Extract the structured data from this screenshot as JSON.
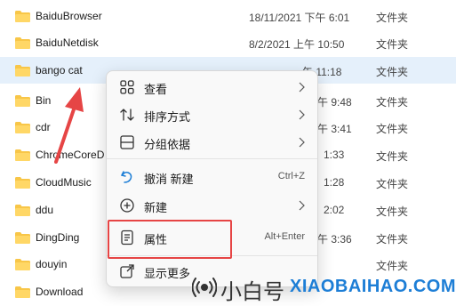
{
  "files": [
    {
      "name": "BaiduBrowser",
      "date": "18/11/2021 下午 6:01",
      "type": "文件夹"
    },
    {
      "name": "BaiduNetdisk",
      "date": "8/2/2021 上午 10:50",
      "type": "文件夹"
    },
    {
      "name": "bango cat",
      "date": "午 11:18",
      "type": "文件夹",
      "selected": true
    },
    {
      "name": "Bin",
      "date": "午 9:48",
      "type": "文件夹"
    },
    {
      "name": "cdr",
      "date": "午 3:41",
      "type": "文件夹"
    },
    {
      "name": "ChromeCoreD",
      "date": "1:33",
      "type": "文件夹"
    },
    {
      "name": "CloudMusic",
      "date": "1:28",
      "type": "文件夹"
    },
    {
      "name": "ddu",
      "date": "2:02",
      "type": "文件夹"
    },
    {
      "name": "DingDing",
      "date": "午 3:36",
      "type": "文件夹"
    },
    {
      "name": "douyin",
      "date": "",
      "type": "文件夹"
    },
    {
      "name": "Download",
      "date": "",
      "type": ""
    }
  ],
  "context_menu": {
    "view": {
      "label": "查看",
      "icon": "grid-icon"
    },
    "sort": {
      "label": "排序方式",
      "icon": "sort-icon"
    },
    "group": {
      "label": "分组依据",
      "icon": "group-icon"
    },
    "undo": {
      "label": "撤消 新建",
      "shortcut": "Ctrl+Z",
      "icon": "undo-icon"
    },
    "new": {
      "label": "新建",
      "icon": "plus-circle-icon"
    },
    "properties": {
      "label": "属性",
      "shortcut": "Alt+Enter",
      "icon": "properties-icon"
    },
    "more": {
      "label": "显示更多",
      "icon": "share-icon"
    }
  },
  "watermark": {
    "cn": "小白号",
    "en": "XIAOBAIHAO.COM"
  },
  "colors": {
    "highlight": "#e64545",
    "arrow": "#e64545",
    "folder": "#f8c648",
    "selection": "#e5f0fb",
    "brand_blue": "#1d7ed6"
  }
}
